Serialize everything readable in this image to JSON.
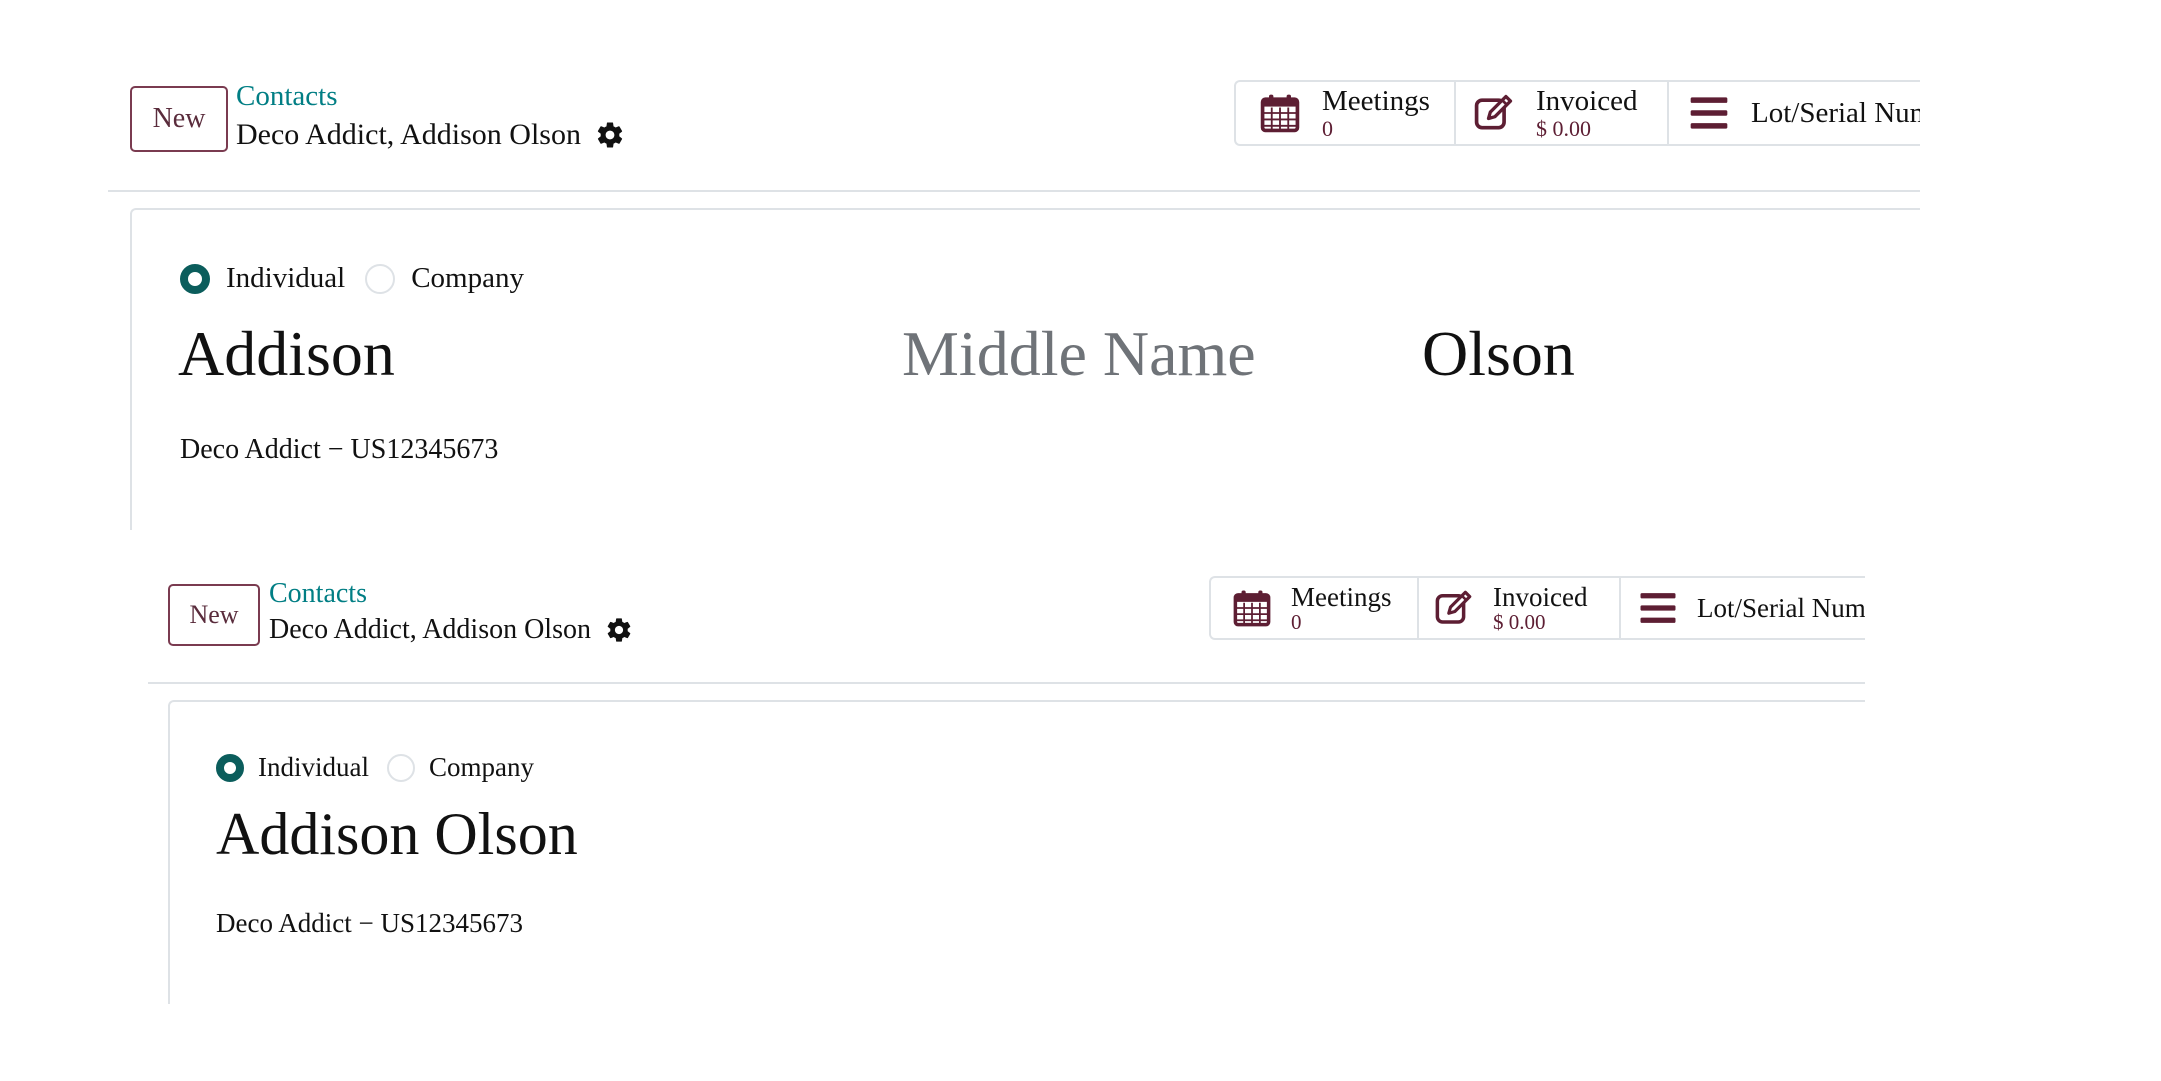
{
  "views": [
    {
      "new_label": "New",
      "breadcrumb_parent": "Contacts",
      "record_name": "Deco Addict, Addison Olson",
      "smart_buttons": {
        "meetings_label": "Meetings",
        "meetings_value": "0",
        "invoiced_label": "Invoiced",
        "invoiced_value": "$ 0.00",
        "lot_label": "Lot/Serial Num"
      },
      "type_options": [
        "Individual",
        "Company"
      ],
      "selected_type": "Individual",
      "first_name": "Addison",
      "middle_name_placeholder": "Middle Name",
      "last_name": "Olson",
      "company_line": "Deco Addict − US12345673"
    },
    {
      "new_label": "New",
      "breadcrumb_parent": "Contacts",
      "record_name": "Deco Addict, Addison Olson",
      "smart_buttons": {
        "meetings_label": "Meetings",
        "meetings_value": "0",
        "invoiced_label": "Invoiced",
        "invoiced_value": "$ 0.00",
        "lot_label": "Lot/Serial Num"
      },
      "type_options": [
        "Individual",
        "Company"
      ],
      "selected_type": "Individual",
      "full_name": "Addison Olson",
      "company_line": "Deco Addict − US12345673"
    }
  ],
  "colors": {
    "brand_teal": "#017e84",
    "radio_checked": "#0b5d5c",
    "icon_maroon": "#5d1e33",
    "border": "#dee2e6",
    "placeholder": "#6f7378"
  },
  "icons": {
    "gear": "gear-icon",
    "meetings": "calendar-icon",
    "invoiced": "pencil-square-icon",
    "lot": "bars-icon"
  }
}
